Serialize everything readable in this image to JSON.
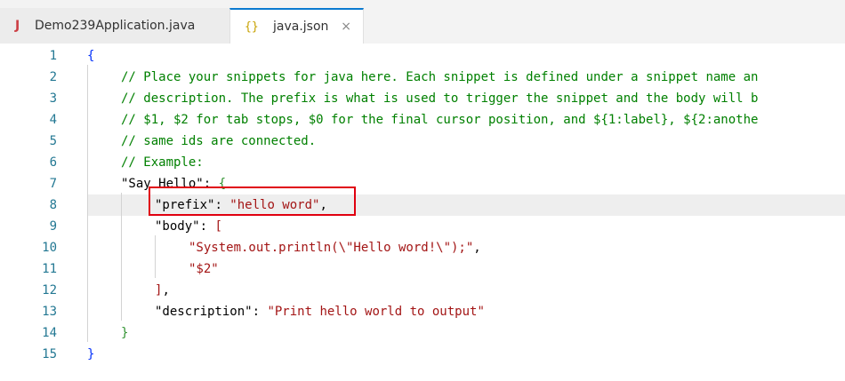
{
  "tabs": [
    {
      "icon": "J",
      "label": "Demo239Application.java",
      "active": false
    },
    {
      "icon": "{}",
      "label": "java.json",
      "active": true,
      "close": "×"
    }
  ],
  "line_numbers": [
    "1",
    "2",
    "3",
    "4",
    "5",
    "6",
    "7",
    "8",
    "9",
    "10",
    "11",
    "12",
    "13",
    "14",
    "15"
  ],
  "code": {
    "l1": {
      "brace": "{"
    },
    "l2": {
      "comment": "// Place your snippets for java here. Each snippet is defined under a snippet name an"
    },
    "l3": {
      "comment": "// description. The prefix is what is used to trigger the snippet and the body will b"
    },
    "l4": {
      "comment": "// $1, $2 for tab stops, $0 for the final cursor position, and ${1:label}, ${2:anothe"
    },
    "l5": {
      "comment": "// same ids are connected."
    },
    "l6": {
      "comment": "// Example:"
    },
    "l7": {
      "key": "\"Say Hello\"",
      "colon": ": ",
      "brace": "{"
    },
    "l8": {
      "key": "\"prefix\"",
      "colon": ": ",
      "value": "\"hello word\"",
      "comma": ","
    },
    "l9": {
      "key": "\"body\"",
      "colon": ": ",
      "bracket": "["
    },
    "l10": {
      "value": "\"System.out.println(\\\"Hello word!\\\");\"",
      "comma": ","
    },
    "l11": {
      "value": "\"$2\""
    },
    "l12": {
      "bracket": "]",
      "comma": ","
    },
    "l13": {
      "key": "\"description\"",
      "colon": ": ",
      "value": "\"Print hello world to output\""
    },
    "l14": {
      "brace": "}"
    },
    "l15": {
      "brace": "}"
    }
  },
  "colors": {
    "accent": "#0a7ad0",
    "highlight_box": "#e0000f",
    "comment": "#008000",
    "key": "#0451a5",
    "string": "#a31515"
  }
}
